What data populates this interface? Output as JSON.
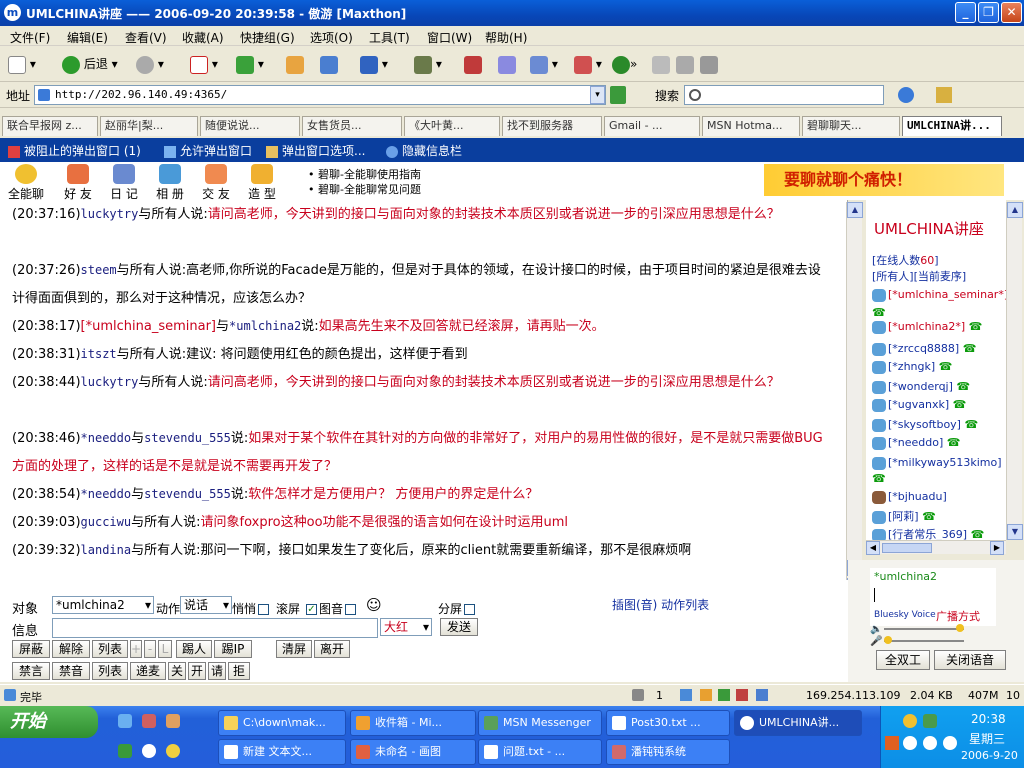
{
  "window": {
    "title": "UMLCHINA讲座 —— 2006-09-20 20:39:58 - 傲游 [Maxthon]",
    "app_icon": "m"
  },
  "menu": [
    "文件(F)",
    "编辑(E)",
    "查看(V)",
    "收藏(A)",
    "快捷组(G)",
    "选项(O)",
    "工具(T)",
    "窗口(W)",
    "帮助(H)"
  ],
  "toolbar": {
    "back": "后退",
    "more": "»"
  },
  "address": {
    "label": "地址",
    "url": "http://202.96.140.49:4365/",
    "search_label": "搜索"
  },
  "tabs": [
    "联合早报网 z...",
    "赵丽华|梨...",
    "随便说说...",
    "女售货员...",
    "《大叶黄...",
    "找不到服务器",
    "Gmail - ...",
    "MSN Hotma...",
    "碧聊聊天...",
    "UMLCHINA讲..."
  ],
  "infobar": [
    "被阻止的弹出窗口 (1)",
    "允许弹出窗口",
    "弹出窗口选项...",
    "隐藏信息栏"
  ],
  "nav": {
    "buttons": [
      "全能聊",
      "好 友",
      "日 记",
      "相 册",
      "交 友",
      "造 型"
    ],
    "links": [
      "• 碧聊-全能聊使用指南",
      "• 碧聊-全能聊常见问题"
    ],
    "banner": "要聊就聊个痛快！"
  },
  "messages": [
    {
      "time": "(20:37:16)",
      "from": "luckytry",
      "mid": "与",
      "to": "所有人",
      "said": "说:",
      "text": "请问高老师，今天讲到的接口与面向对象的封装技术本质区别或者说进一步的引深应用思想是什么？",
      "red": true
    },
    {
      "time": "(20:37:26)",
      "from": "steem",
      "mid": "与",
      "to": "所有人",
      "said": "说:",
      "text": "高老师,你所说的Facade是万能的，但是对于具体的领域，在设计接口的时候，由于项目时间的紧迫是很难去设计得面面俱到的，那么对于这种情况，应该怎么办？",
      "red": false
    },
    {
      "time": "(20:38:17)",
      "from": "[*umlchina_seminar]",
      "mid": "与",
      "to": "*umlchina2",
      "said": "说:",
      "text": "如果高先生来不及回答就已经滚屏，请再贴一次。",
      "red": true
    },
    {
      "time": "(20:38:31)",
      "from": "itszt",
      "mid": "与",
      "to": "所有人",
      "said": "说:",
      "text": "建议: 将问题使用红色的颜色提出，这样便于看到",
      "red": false
    },
    {
      "time": "(20:38:44)",
      "from": "luckytry",
      "mid": "与",
      "to": "所有人",
      "said": "说:",
      "text": "请问高老师，今天讲到的接口与面向对象的封装技术本质区别或者说进一步的引深应用思想是什么？",
      "red": true
    },
    {
      "time": "(20:38:46)",
      "from": "*needdo",
      "mid": "与",
      "to": "stevendu_555",
      "said": "说:",
      "text": "如果对于某个软件在其针对的方向做的非常好了，对用户的易用性做的很好，是不是就只需要做BUG方面的处理了，这样的话是不是就是说不需要再开发了？",
      "red": true
    },
    {
      "time": "(20:38:54)",
      "from": "*needdo",
      "mid": "与",
      "to": "stevendu_555",
      "said": "说:",
      "text": "软件怎样才是方便用户？ 方便用户的界定是什么？",
      "red": true
    },
    {
      "time": "(20:39:03)",
      "from": "gucciwu",
      "mid": "与",
      "to": "所有人",
      "said": "说:",
      "text": "请问象foxpro这种oo功能不是很强的语言如何在设计时运用uml",
      "red": true
    },
    {
      "time": "(20:39:32)",
      "from": "landina",
      "mid": "与",
      "to": "所有人",
      "said": "说:",
      "text": "那问一下啊，接口如果发生了变化后，原来的client就需要重新编译，那不是很麻烦啊",
      "red": false
    }
  ],
  "room": {
    "title": "UMLCHINA讲座",
    "online_label": "[在线人数",
    "online_count": "60",
    "online_close": "]",
    "order": "[所有人][当前麦序]",
    "users": [
      "[*umlchina_seminar*]",
      "[*umlchina2*]",
      "[*zrccq8888]",
      "[*zhngk]",
      "[*wonderqj]",
      "[*ugvanxk]",
      "[*skysoftboy]",
      "[*needdo]",
      "[*milkyway513kimo]",
      "[*bjhuadu]",
      "[阿莉]",
      "[行者常乐_369]"
    ]
  },
  "input": {
    "target_label": "对象",
    "target_value": "*umlchina2",
    "action_label": "动作",
    "action_value": "说话",
    "whisper": "悄悄",
    "scroll": "滚屏",
    "image": "图音",
    "split": "分屏",
    "info_label": "信息",
    "color_value": "大红",
    "send": "发送",
    "link_text": "插图(音) 动作列表",
    "buttons_row1": [
      "屏蔽",
      "解除",
      "列表",
      "+",
      "-",
      "L",
      "踢人",
      "踢IP",
      "清屏",
      "离开"
    ],
    "buttons_row2": [
      "禁言",
      "禁音",
      "列表",
      "递麦",
      "关",
      "开",
      "请",
      "拒"
    ]
  },
  "voice": {
    "user": "*umlchina2",
    "brand": "Bluesky Voice",
    "mode": "广播方式",
    "full_duplex": "全双工",
    "close_voice": "关闭语音"
  },
  "status": {
    "text": "完毕",
    "count": "1",
    "ip": "169.254.113.109",
    "size": "2.04 KB",
    "mem": "407M",
    "n": "10"
  },
  "taskbar": {
    "start": "开始",
    "row1": [
      "C:\\down\\mak...",
      "收件箱 - Mi...",
      "MSN Messenger",
      "Post30.txt ...",
      "UMLCHINA讲..."
    ],
    "row2": [
      "新建 文本文...",
      "未命名 - 画图",
      "问题.txt - ...",
      "潘钝钝系统"
    ],
    "time": "20:38",
    "weekday": "星期三",
    "date": "2006-9-20"
  }
}
